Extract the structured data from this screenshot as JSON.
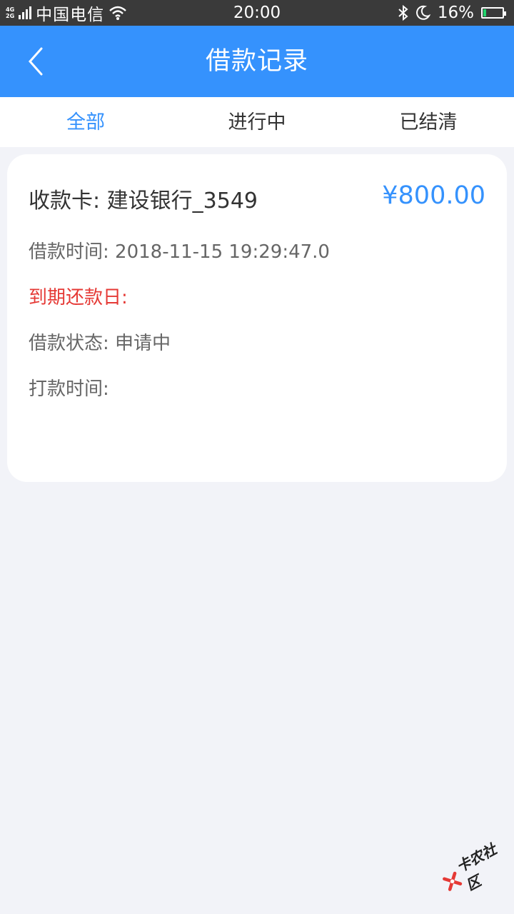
{
  "status_bar": {
    "network_top": "4G",
    "network_bottom": "2G",
    "carrier": "中国电信",
    "time": "20:00",
    "battery": "16%",
    "battery_level": 0.16,
    "icons": [
      "signal-icon",
      "wifi-icon",
      "bluetooth-icon",
      "moon-icon",
      "battery-icon"
    ]
  },
  "header": {
    "title": "借款记录",
    "back_icon": "chevron-left-icon"
  },
  "tabs": [
    {
      "label": "全部",
      "active": true
    },
    {
      "label": "进行中",
      "active": false
    },
    {
      "label": "已结清",
      "active": false
    }
  ],
  "record": {
    "card_label": "收款卡: 建设银行_3549",
    "amount": "¥800.00",
    "loan_time": "借款时间: 2018-11-15 19:29:47.0",
    "due_date": "到期还款日:",
    "status": "借款状态: 申请中",
    "payment_time": "打款时间:"
  },
  "watermark": {
    "text": "卡农社区"
  },
  "colors": {
    "accent": "#3592fd",
    "due_red": "#e53935",
    "background": "#f2f3f8",
    "status_bar": "#3a3a3a"
  }
}
